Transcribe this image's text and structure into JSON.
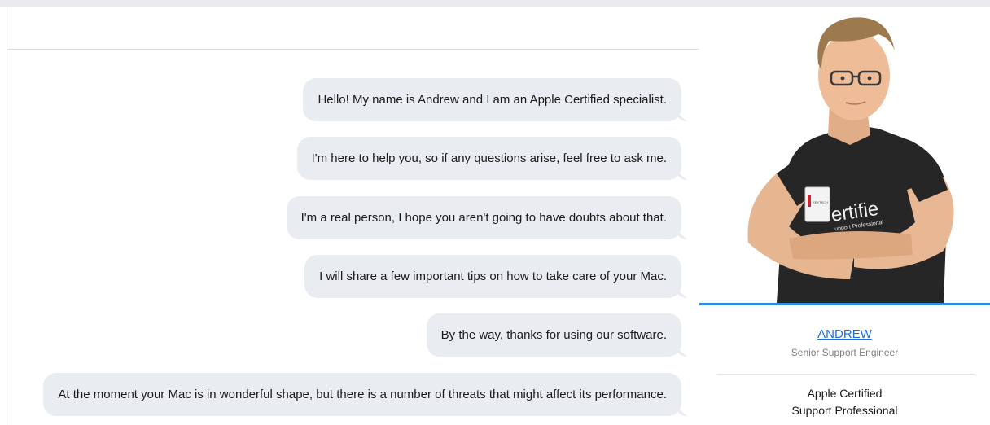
{
  "chat": {
    "messages": [
      "Hello! My name is Andrew and I am an Apple Certified specialist.",
      "I'm here to help you, so if any questions arise, feel free to ask me.",
      "I'm a real person, I hope you aren't going to have doubts about that.",
      "I will share a few important tips on how to take care of your Mac.",
      "By the way, thanks for using our software.",
      "At the moment your Mac is in wonderful shape, but there is a number of threats that might affect its performance."
    ]
  },
  "profile": {
    "name": "ANDREW",
    "title": "Senior Support Engineer",
    "certification_line1": "Apple Certified",
    "certification_line2": "Support Professional",
    "shirt_print": "ertifie",
    "shirt_print_small": "upport Professional",
    "badge_text": "KEYTECH"
  },
  "colors": {
    "accent": "#2f8be2",
    "link": "#1d6fd6",
    "bubble": "#e9ecf0",
    "shirt": "#262626",
    "skin": "#e8b894"
  }
}
